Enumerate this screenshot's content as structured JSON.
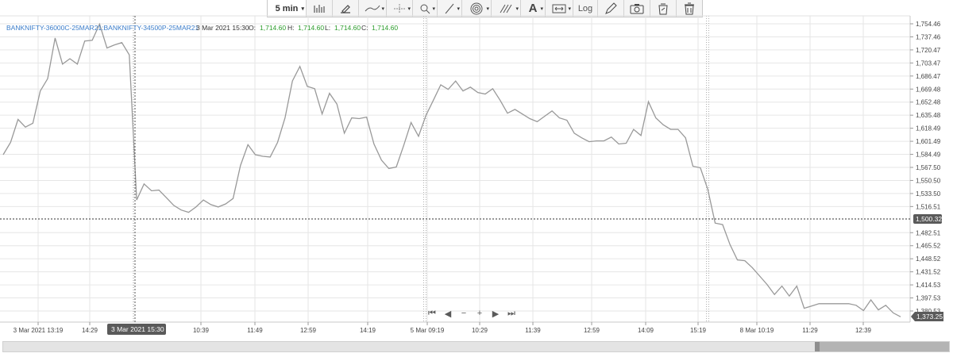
{
  "toolbar": {
    "interval": "5 min",
    "log_label": "Log",
    "icons": [
      "bar-style-icon",
      "draw-pencil-icon",
      "line-type-icon",
      "crosshair-icon",
      "zoom-icon",
      "trendline-icon",
      "fib-circle-icon",
      "fib-lines-icon",
      "text-icon",
      "range-icon",
      "log-toggle",
      "pencil-icon",
      "camera-icon",
      "share-icon",
      "delete-icon"
    ]
  },
  "header": {
    "symbol": "BANKNIFTY-36000C-25MAR21:BANKNIFTY-34500P-25MAR21",
    "datetime": "3 Mar 2021 15:30",
    "o_label": "O:",
    "o": "1,714.60",
    "h_label": "H:",
    "h": "1,714.60",
    "l_label": "L:",
    "l": "1,714.60",
    "c_label": "C:",
    "c": "1,714.60"
  },
  "crosshair": {
    "x_label": "3 Mar 2021 15:30",
    "y_label": "1,500.32",
    "y_value": 1500.32
  },
  "last_price": {
    "label": "1,373.25",
    "value": 1373.25
  },
  "colors": {
    "line": "#999999",
    "grid": "#e6e6e6",
    "ohlc_value": "#2c9c2c",
    "symbol": "#3a7cc9",
    "label_bg": "#5a5a5a"
  },
  "chart_data": {
    "type": "line",
    "ylim": [
      1368,
      1764
    ],
    "y_ticks": [
      "1,754.46",
      "1,737.46",
      "1,720.47",
      "1,703.47",
      "1,686.47",
      "1,669.48",
      "1,652.48",
      "1,635.48",
      "1,618.49",
      "1,601.49",
      "1,584.49",
      "1,567.50",
      "1,550.50",
      "1,533.50",
      "1,516.51",
      "1,482.51",
      "1,465.52",
      "1,448.52",
      "1,431.52",
      "1,414.53",
      "1,397.53",
      "1,380.53"
    ],
    "x_tick_labels": [
      "3 Mar 2021 13:19",
      "14:29",
      "10:39",
      "11:49",
      "12:59",
      "14:19",
      "5 Mar 09:19",
      "10:29",
      "11:39",
      "12:59",
      "14:09",
      "15:19",
      "8 Mar 10:19",
      "11:29",
      "12:39"
    ],
    "session_breaks": [
      "3 Mar 15:30",
      "5 Mar 09:15",
      "5 Mar 15:30"
    ],
    "values": [
      1584,
      1600,
      1630,
      1620,
      1625,
      1667,
      1683,
      1736,
      1702,
      1709,
      1702,
      1732,
      1733,
      1754,
      1723,
      1727,
      1730,
      1714,
      1525,
      1546,
      1537,
      1538,
      1528,
      1518,
      1512,
      1509,
      1516,
      1525,
      1519,
      1516,
      1520,
      1527,
      1570,
      1597,
      1584,
      1582,
      1581,
      1600,
      1632,
      1680,
      1699,
      1673,
      1670,
      1637,
      1664,
      1650,
      1612,
      1632,
      1631,
      1633,
      1598,
      1577,
      1566,
      1568,
      1596,
      1626,
      1608,
      1635,
      1655,
      1675,
      1669,
      1680,
      1667,
      1672,
      1665,
      1663,
      1670,
      1655,
      1638,
      1643,
      1637,
      1631,
      1627,
      1634,
      1641,
      1632,
      1629,
      1612,
      1606,
      1601,
      1602,
      1602,
      1607,
      1598,
      1599,
      1617,
      1609,
      1653,
      1632,
      1623,
      1617,
      1617,
      1606,
      1569,
      1567,
      1539,
      1495,
      1493,
      1467,
      1447,
      1446,
      1437,
      1426,
      1415,
      1402,
      1413,
      1400,
      1413,
      1384,
      1387,
      1390,
      1390,
      1390,
      1390,
      1390,
      1388,
      1381,
      1395,
      1382,
      1388,
      1378,
      1373
    ]
  }
}
